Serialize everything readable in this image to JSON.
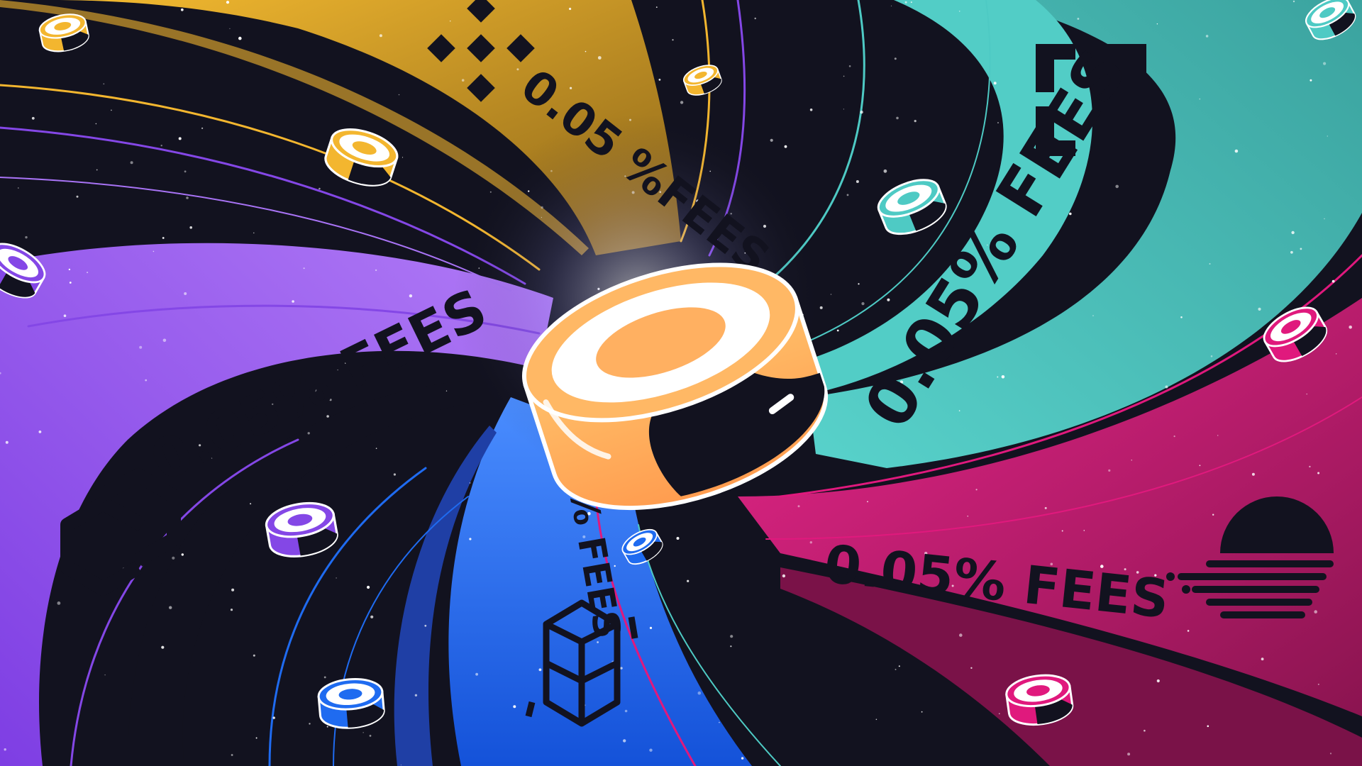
{
  "colors": {
    "space": "#12121f",
    "binance": "#f3b62f",
    "polygon": "#8447e6",
    "fantom": "#1f6bf0",
    "harmony": "#4ecac4",
    "moonriver": "#e0197d",
    "sushi_orange": "#ffb061",
    "sushi_white": "#ffffff"
  },
  "labels": {
    "binance_fee": "0.05 %FEES",
    "harmony_fee": "0.05% FEES",
    "polygon_fee": "0.05% FEES",
    "fantom_fee": "05% FEES",
    "moonriver_fee": "0.05% FEES"
  },
  "icons": {
    "binance": "binance-logo-icon",
    "harmony": "harmony-logo-icon",
    "polygon": "polygon-logo-icon",
    "fantom": "fantom-logo-icon",
    "moonriver": "moonriver-logo-icon",
    "token": "sushi-token-icon"
  }
}
